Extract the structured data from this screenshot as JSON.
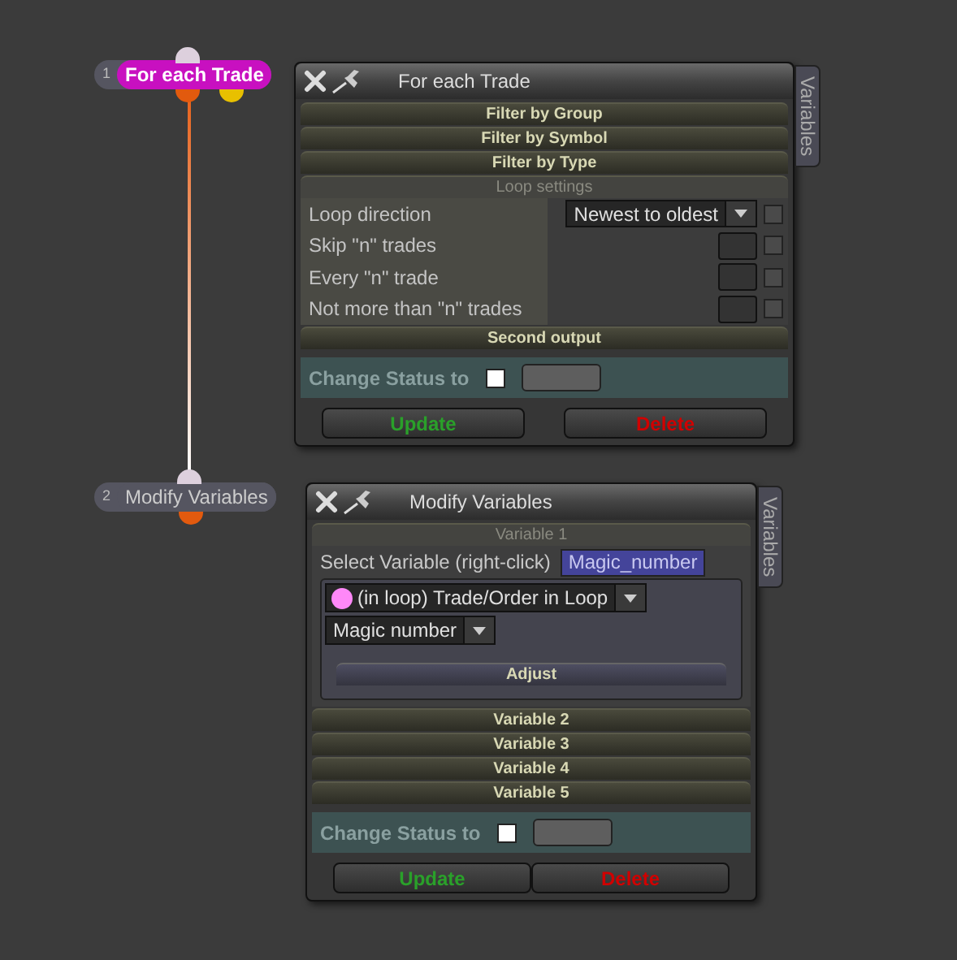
{
  "nodes": [
    {
      "number": "1",
      "label": "For each Trade",
      "selected": true
    },
    {
      "number": "2",
      "label": "Modify Variables",
      "selected": false
    }
  ],
  "panels": [
    {
      "title": "For each Trade",
      "side_tab": "Variables",
      "sections": [
        {
          "kind": "section",
          "label": "Filter by Group",
          "expanded": false
        },
        {
          "kind": "section",
          "label": "Filter by Symbol",
          "expanded": false
        },
        {
          "kind": "section",
          "label": "Filter by Type",
          "expanded": false
        },
        {
          "kind": "loop",
          "label": "Loop settings",
          "expanded": true,
          "rows": [
            {
              "kind": "select",
              "label": "Loop direction",
              "value": "Newest to oldest",
              "checked": false
            },
            {
              "kind": "number",
              "label": "Skip \"n\" trades",
              "checked": false
            },
            {
              "kind": "number",
              "label": "Every \"n\" trade",
              "checked": false
            },
            {
              "kind": "number",
              "label": "Not more than \"n\" trades",
              "checked": false
            }
          ]
        },
        {
          "kind": "section",
          "label": "Second output",
          "expanded": false
        }
      ],
      "status": {
        "label": "Change Status to",
        "checked": false
      },
      "buttons": [
        {
          "kind": "update",
          "label": "Update"
        },
        {
          "kind": "delete",
          "label": "Delete"
        }
      ]
    },
    {
      "title": "Modify Variables",
      "side_tab": "Variables",
      "sections": [
        {
          "kind": "variable",
          "label": "Variable 1",
          "expanded": true,
          "select_label": "Select Variable (right-click)",
          "variable": "Magic_number",
          "source": {
            "label": "(in loop) Trade/Order in Loop",
            "color": "#ff88f8"
          },
          "property": "Magic number",
          "action": "Adjust"
        },
        {
          "kind": "section",
          "label": "Variable 2",
          "expanded": false
        },
        {
          "kind": "section",
          "label": "Variable 3",
          "expanded": false
        },
        {
          "kind": "section",
          "label": "Variable 4",
          "expanded": false
        },
        {
          "kind": "section",
          "label": "Variable 5",
          "expanded": false
        }
      ],
      "status": {
        "label": "Change Status to",
        "checked": false
      },
      "buttons": [
        {
          "kind": "update",
          "label": "Update"
        },
        {
          "kind": "delete",
          "label": "Delete"
        }
      ]
    }
  ]
}
